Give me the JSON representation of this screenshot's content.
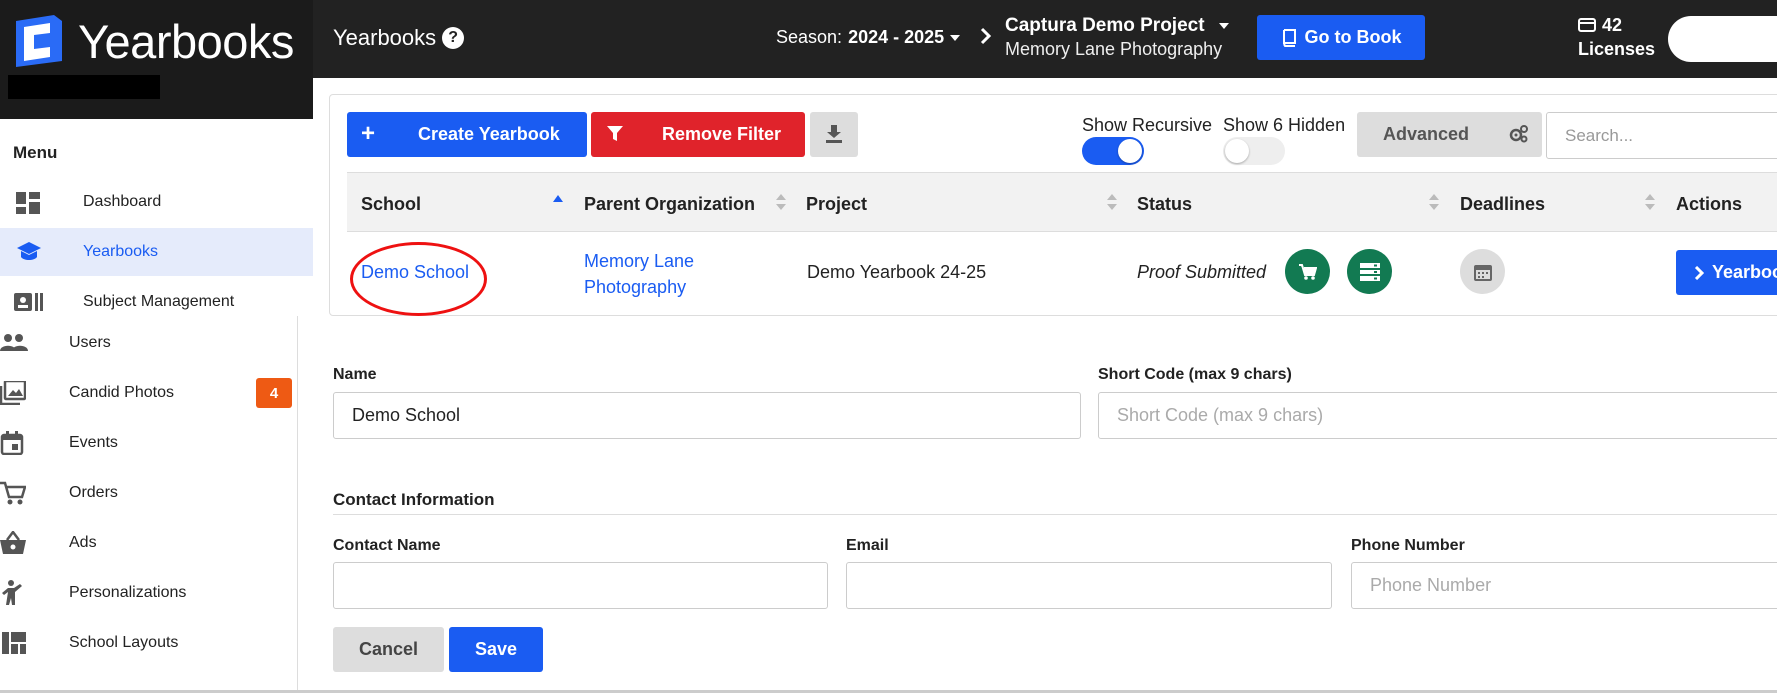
{
  "app": {
    "brand": "Yearbooks",
    "page_title": "Yearbooks",
    "help_glyph": "?",
    "season_label": "Season:",
    "season_value": "2024 - 2025",
    "project_name": "Captura Demo Project",
    "project_org": "Memory Lane Photography",
    "go_to_book_label": "Go to Book",
    "licenses_count": "42",
    "licenses_label": "Licenses",
    "accent": "#1a5cf2",
    "danger": "#e0232b",
    "success": "#127a52",
    "badge_color": "#ee5a14"
  },
  "sidebar": {
    "menu_title": "Menu",
    "items": [
      {
        "label": "Dashboard",
        "icon": "dashboard-icon"
      },
      {
        "label": "Yearbooks",
        "icon": "graduation-cap-icon",
        "active": true
      },
      {
        "label": "Subject Management",
        "icon": "id-card-icon"
      },
      {
        "label": "Users",
        "icon": "people-icon"
      },
      {
        "label": "Candid Photos",
        "icon": "photo-library-icon",
        "badge": "4"
      },
      {
        "label": "Events",
        "icon": "calendar-icon"
      },
      {
        "label": "Orders",
        "icon": "cart-icon"
      },
      {
        "label": "Ads",
        "icon": "basket-icon"
      },
      {
        "label": "Personalizations",
        "icon": "person-icon"
      },
      {
        "label": "School Layouts",
        "icon": "layout-icon"
      }
    ]
  },
  "toolbar": {
    "create_label": "Create Yearbook",
    "create_glyph": "+",
    "remove_filter_label": "Remove Filter",
    "show_recursive_label": "Show Recursive",
    "show_recursive_on": true,
    "show_hidden_label": "Show 6 Hidden",
    "show_hidden_on": false,
    "advanced_label": "Advanced",
    "search_placeholder": "Search..."
  },
  "table": {
    "columns": [
      "School",
      "Parent Organization",
      "Project",
      "Status",
      "Deadlines",
      "Actions"
    ],
    "rows": [
      {
        "school": "Demo School",
        "parent_org_line1": "Memory Lane",
        "parent_org_line2": "Photography",
        "project": "Demo Yearbook 24-25",
        "status": "Proof Submitted",
        "action_label": "Yearbook"
      }
    ]
  },
  "form": {
    "name_label": "Name",
    "name_value": "Demo School",
    "short_code_label": "Short Code (max 9 chars)",
    "short_code_placeholder": "Short Code (max 9 chars)",
    "contact_section": "Contact Information",
    "contact_name_label": "Contact Name",
    "contact_name_value": "",
    "email_label": "Email",
    "email_value": "",
    "phone_label": "Phone Number",
    "phone_placeholder": "Phone Number",
    "cancel_label": "Cancel",
    "save_label": "Save"
  }
}
